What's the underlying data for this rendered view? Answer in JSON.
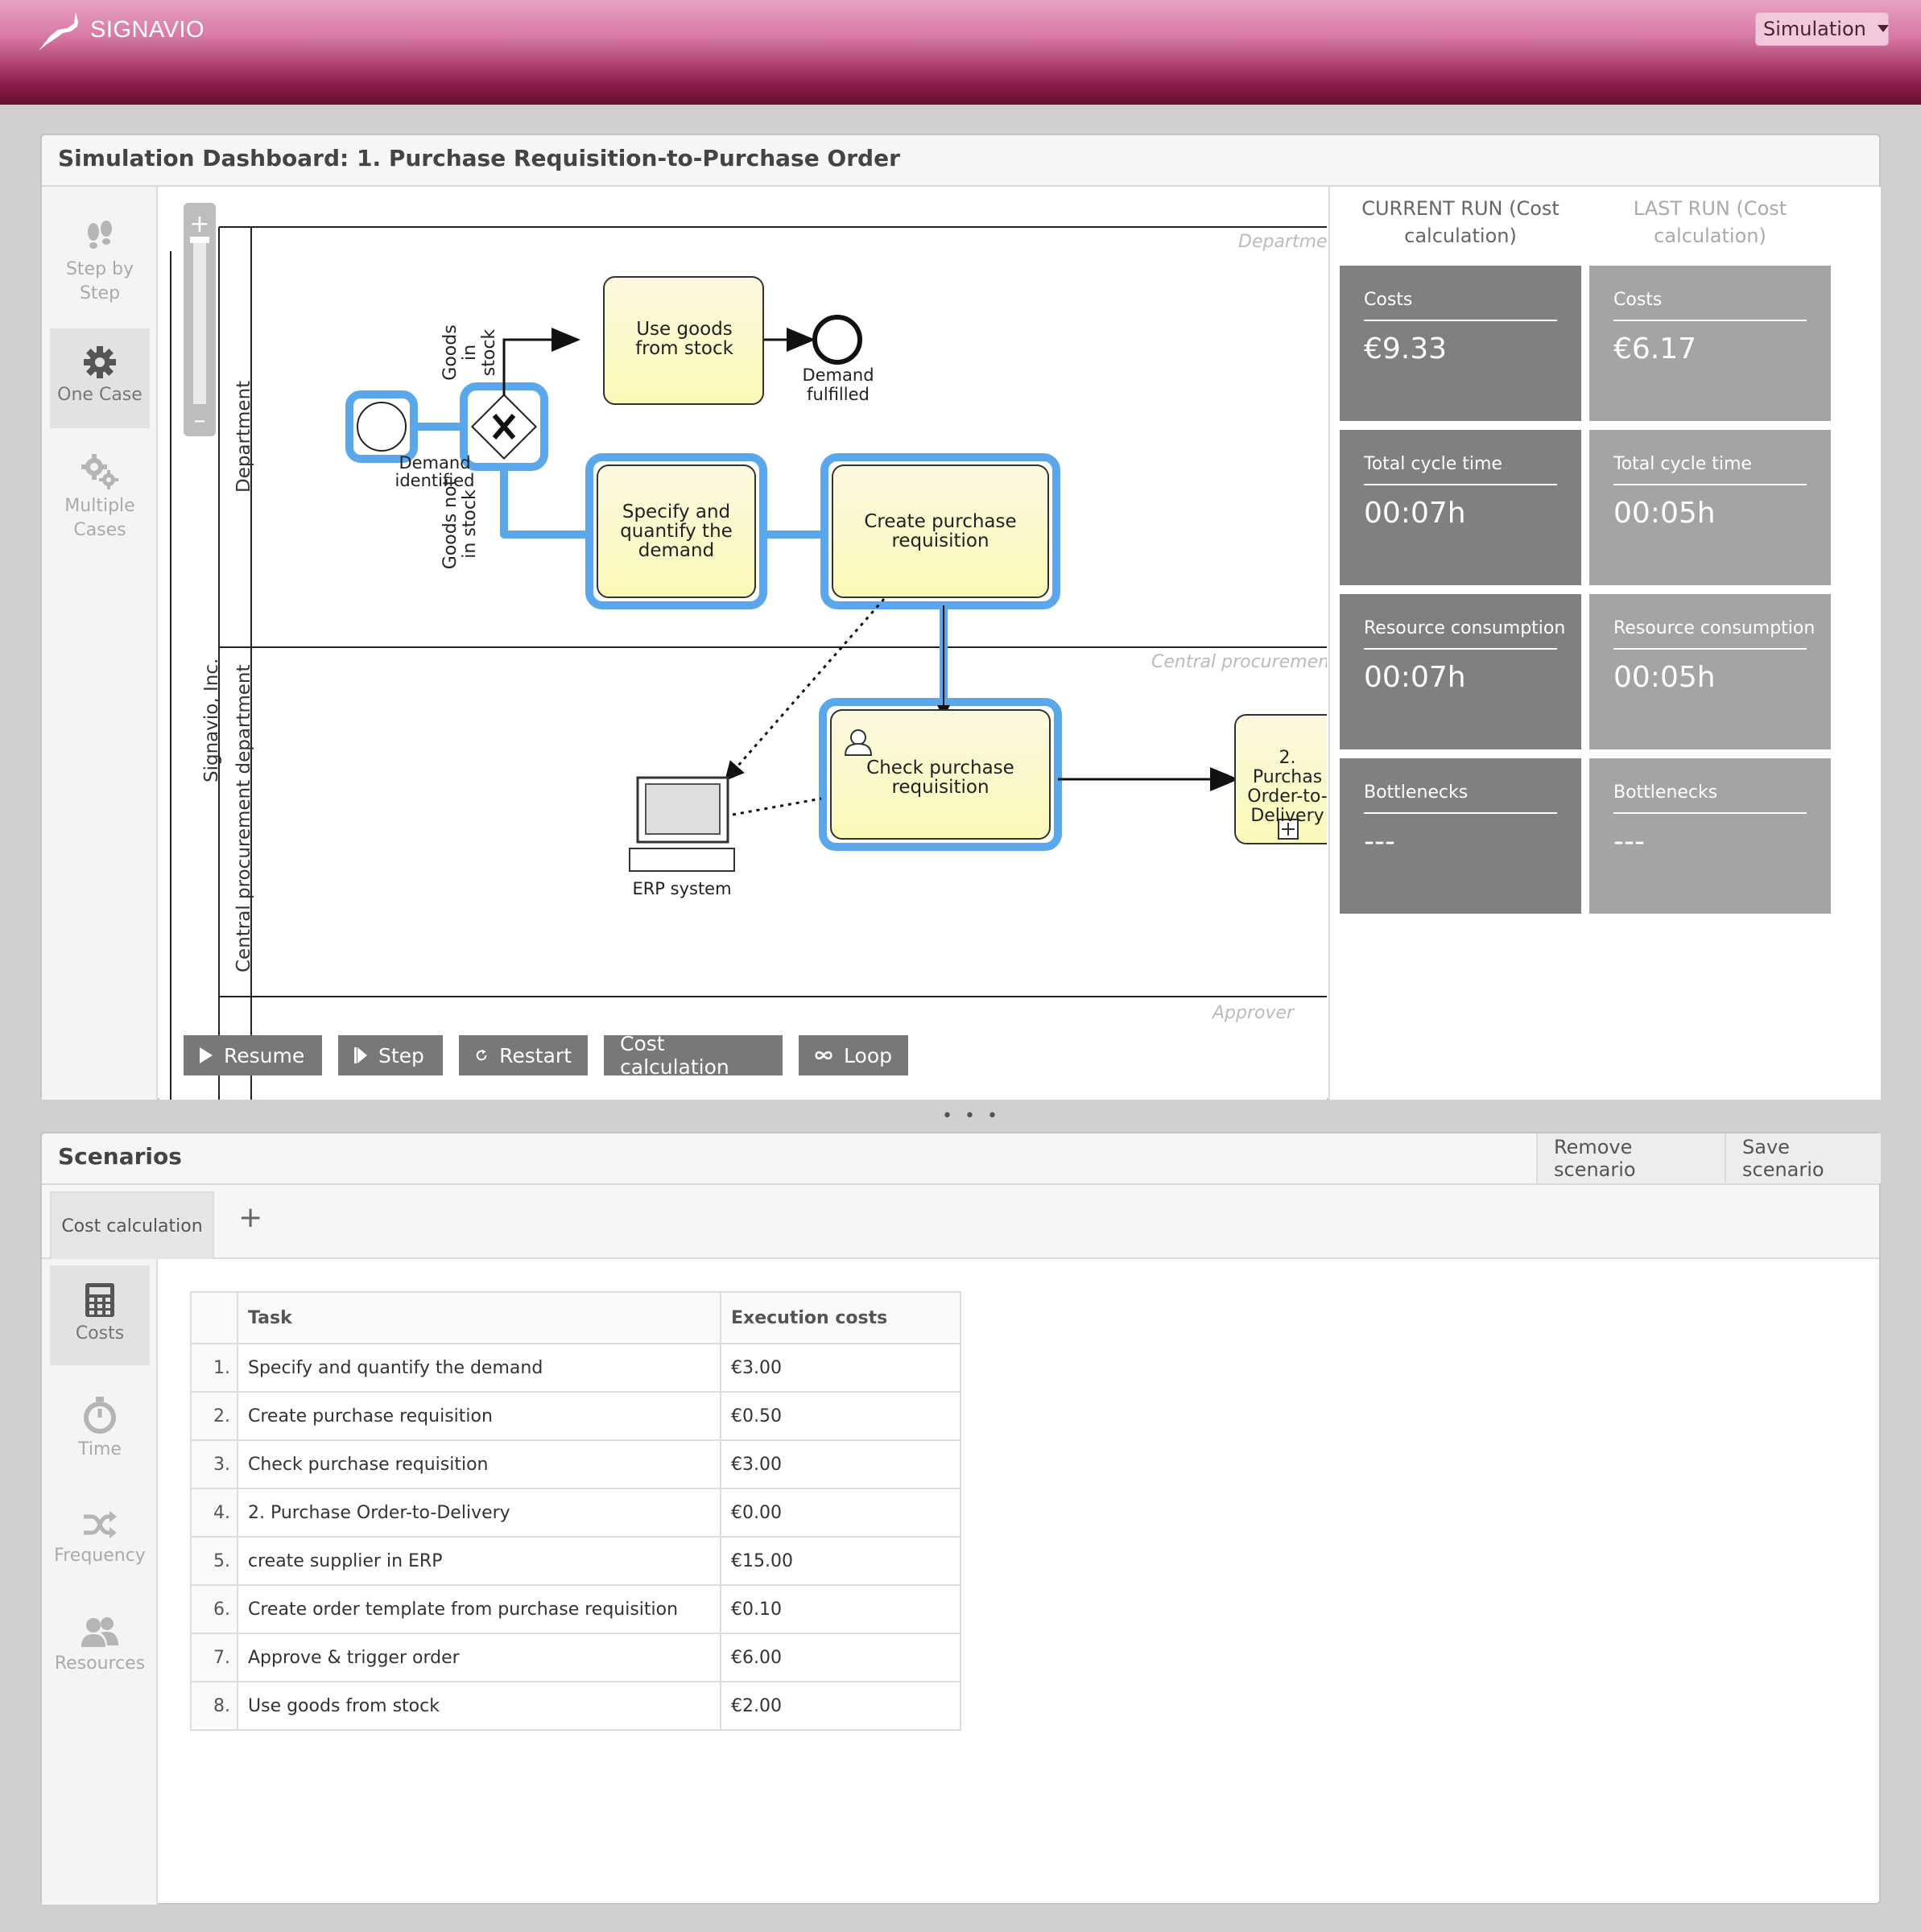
{
  "header": {
    "brand": "SIGNAVIO",
    "mode_dropdown": "Simulation"
  },
  "dashboard": {
    "title": "Simulation Dashboard: 1. Purchase Requisition-to-Purchase Order",
    "modes": [
      {
        "label": "Step by Step",
        "icon": "footsteps-icon"
      },
      {
        "label": "One Case",
        "icon": "gear-icon"
      },
      {
        "label": "Multiple Cases",
        "icon": "gears-icon"
      }
    ],
    "active_mode": "One Case",
    "diagram": {
      "pool": "Signavio, Inc.",
      "lanes": [
        "Department",
        "Central procurement department"
      ],
      "lane_captions": [
        "Department",
        "Central procurement de",
        "Approver"
      ],
      "start_event": "Demand identified",
      "gateway_labels": [
        "Goods in stock",
        "Goods not in stock"
      ],
      "tasks": {
        "use_goods": "Use goods from stock",
        "specify": "Specify and quantify the demand",
        "create_req": "Create purchase requisition",
        "check_req": "Check purchase requisition",
        "subprocess": "2. Purchas Order-to- Delivery"
      },
      "end_event": "Demand fulfilled",
      "data_object": "ERP system"
    },
    "controls": {
      "resume": "Resume",
      "step": "Step",
      "restart": "Restart",
      "scenario": "Cost calculation",
      "loop": "Loop"
    },
    "current_run_header": "CURRENT RUN (Cost calculation)",
    "last_run_header": "LAST RUN (Cost calculation)",
    "metrics": [
      {
        "label": "Costs",
        "current": "€9.33",
        "last": "€6.17"
      },
      {
        "label": "Total cycle time",
        "current": "00:07h",
        "last": "00:05h"
      },
      {
        "label": "Resource consumption",
        "current": "00:07h",
        "last": "00:05h"
      },
      {
        "label": "Bottlenecks",
        "current": "---",
        "last": "---"
      }
    ]
  },
  "scenarios": {
    "title": "Scenarios",
    "remove": "Remove scenario",
    "save": "Save scenario",
    "tab": "Cost calculation",
    "add_tab": "+",
    "side": [
      {
        "label": "Costs",
        "icon": "calculator-icon"
      },
      {
        "label": "Time",
        "icon": "stopwatch-icon"
      },
      {
        "label": "Frequency",
        "icon": "shuffle-icon"
      },
      {
        "label": "Resources",
        "icon": "people-icon"
      }
    ],
    "table": {
      "headers": [
        "Task",
        "Execution costs"
      ],
      "rows": [
        {
          "n": "1.",
          "task": "Specify and quantify the demand",
          "cost": "€3.00"
        },
        {
          "n": "2.",
          "task": "Create purchase requisition",
          "cost": "€0.50"
        },
        {
          "n": "3.",
          "task": "Check purchase requisition",
          "cost": "€3.00"
        },
        {
          "n": "4.",
          "task": "2. Purchase Order-to-Delivery",
          "cost": "€0.00"
        },
        {
          "n": "5.",
          "task": "create supplier in ERP",
          "cost": "€15.00"
        },
        {
          "n": "6.",
          "task": "Create order template from purchase requisition",
          "cost": "€0.10"
        },
        {
          "n": "7.",
          "task": "Approve & trigger order",
          "cost": "€6.00"
        },
        {
          "n": "8.",
          "task": "Use goods from stock",
          "cost": "€2.00"
        }
      ]
    }
  },
  "colors": {
    "brand": "#a8386a",
    "highlight": "#5aa7ec",
    "task_fill": "#fcfcc8"
  }
}
